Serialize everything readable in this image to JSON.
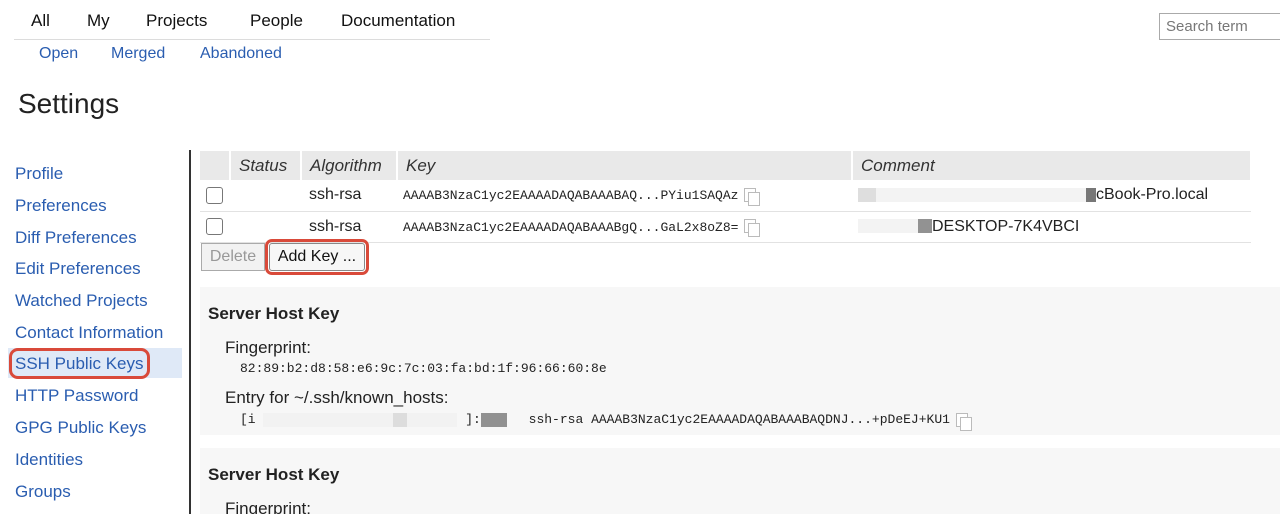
{
  "topnav": {
    "items": [
      "All",
      "My",
      "Projects",
      "People",
      "Documentation"
    ],
    "sub_items": [
      "Open",
      "Merged",
      "Abandoned"
    ]
  },
  "search": {
    "placeholder": "Search term"
  },
  "page_title": "Settings",
  "sidebar": {
    "items": [
      "Profile",
      "Preferences",
      "Diff Preferences",
      "Edit Preferences",
      "Watched Projects",
      "Contact Information",
      "SSH Public Keys",
      "HTTP Password",
      "GPG Public Keys",
      "Identities",
      "Groups"
    ],
    "active_index": 6
  },
  "ssh_table": {
    "headers": [
      "",
      "Status",
      "Algorithm",
      "Key",
      "Comment"
    ],
    "rows": [
      {
        "algorithm": "ssh-rsa",
        "key": "AAAAB3NzaC1yc2EAAAADAQABAAABAQ...PYiu1SAQAz",
        "comment": "cBook-Pro.local"
      },
      {
        "algorithm": "ssh-rsa",
        "key": "AAAAB3NzaC1yc2EAAAADAQABAAABgQ...GaL2x8oZ8=",
        "comment": "DESKTOP-7K4VBCI"
      }
    ]
  },
  "buttons": {
    "delete": "Delete",
    "add_key": "Add Key ..."
  },
  "server_host_keys": [
    {
      "heading": "Server Host Key",
      "fingerprint_label": "Fingerprint:",
      "fingerprint": "82:89:b2:d8:58:e6:9c:7c:03:fa:bd:1f:96:66:60:8e",
      "entry_label": "Entry for ~/.ssh/known_hosts:",
      "entry_prefix": "[i",
      "entry_sep": "]:",
      "entry_value": "ssh-rsa AAAAB3NzaC1yc2EAAAADAQABAAABAQDNJ...+pDeEJ+KU1"
    },
    {
      "heading": "Server Host Key",
      "fingerprint_label": "Fingerprint:"
    }
  ],
  "colors": {
    "link": "#2a5db0",
    "highlight": "#d94a3a",
    "active_bg": "#dfe9f7"
  }
}
